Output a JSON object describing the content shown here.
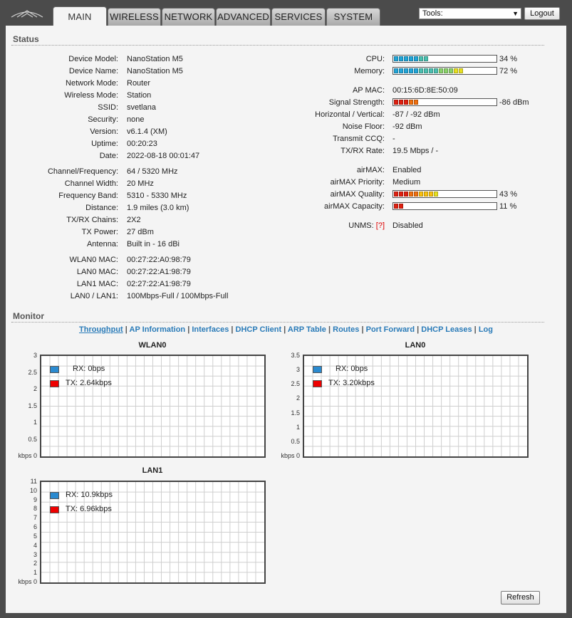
{
  "header": {
    "tabs": [
      {
        "label": "MAIN",
        "active": true
      },
      {
        "label": "WIRELESS"
      },
      {
        "label": "NETWORK"
      },
      {
        "label": "ADVANCED"
      },
      {
        "label": "SERVICES"
      },
      {
        "label": "SYSTEM"
      }
    ],
    "tools_label": "Tools:",
    "logout_label": "Logout",
    "logo_icon": "ubiquiti-logo-icon"
  },
  "status": {
    "title": "Status",
    "left": [
      {
        "label": "Device Model:",
        "value": "NanoStation M5"
      },
      {
        "label": "Device Name:",
        "value": "NanoStation M5"
      },
      {
        "label": "Network Mode:",
        "value": "Router"
      },
      {
        "label": "Wireless Mode:",
        "value": "Station"
      },
      {
        "label": "SSID:",
        "value": "svetlana"
      },
      {
        "label": "Security:",
        "value": "none"
      },
      {
        "label": "Version:",
        "value": "v6.1.4 (XM)"
      },
      {
        "label": "Uptime:",
        "value": "00:20:23"
      },
      {
        "label": "Date:",
        "value": "2022-08-18 00:01:47"
      },
      {
        "label": "Channel/Frequency:",
        "value": "64 / 5320 MHz"
      },
      {
        "label": "Channel Width:",
        "value": "20 MHz"
      },
      {
        "label": "Frequency Band:",
        "value": "5310 - 5330 MHz"
      },
      {
        "label": "Distance:",
        "value": "1.9 miles (3.0 km)"
      },
      {
        "label": "TX/RX Chains:",
        "value": "2X2"
      },
      {
        "label": "TX Power:",
        "value": "27 dBm"
      },
      {
        "label": "Antenna:",
        "value": "Built in - 16 dBi"
      },
      {
        "label": "WLAN0 MAC:",
        "value": "00:27:22:A0:98:79"
      },
      {
        "label": "LAN0 MAC:",
        "value": "00:27:22:A1:98:79"
      },
      {
        "label": "LAN1 MAC:",
        "value": "02:27:22:A1:98:79"
      },
      {
        "label": "LAN0 / LAN1:",
        "value": "100Mbps-Full / 100Mbps-Full"
      }
    ],
    "cpu": {
      "label": "CPU:",
      "value": "34 %",
      "percent": 34
    },
    "memory": {
      "label": "Memory:",
      "value": "72 %",
      "percent": 72
    },
    "ap_mac": {
      "label": "AP MAC:",
      "value": "00:15:6D:8E:50:09"
    },
    "signal": {
      "label": "Signal Strength:",
      "value": "-86 dBm",
      "percent": 25
    },
    "hv": {
      "label": "Horizontal / Vertical:",
      "value": "-87 / -92 dBm"
    },
    "noise": {
      "label": "Noise Floor:",
      "value": "-92 dBm"
    },
    "ccq": {
      "label": "Transmit CCQ:",
      "value": "-"
    },
    "txrx": {
      "label": "TX/RX Rate:",
      "value": "19.5 Mbps / -"
    },
    "airmax": {
      "label": "airMAX:",
      "value": "Enabled"
    },
    "airmax_priority": {
      "label": "airMAX Priority:",
      "value": "Medium"
    },
    "airmax_quality": {
      "label": "airMAX Quality:",
      "value": "43 %",
      "percent": 43
    },
    "airmax_capacity": {
      "label": "airMAX Capacity:",
      "value": "11 %",
      "percent": 11
    },
    "unms": {
      "label": "UNMS:",
      "help": "[?]",
      "value": "Disabled"
    }
  },
  "monitor": {
    "title": "Monitor",
    "links": [
      {
        "label": "Throughput",
        "active": true
      },
      {
        "label": "AP Information"
      },
      {
        "label": "Interfaces"
      },
      {
        "label": "DHCP Client"
      },
      {
        "label": "ARP Table"
      },
      {
        "label": "Routes"
      },
      {
        "label": "Port Forward"
      },
      {
        "label": "DHCP Leases"
      },
      {
        "label": "Log"
      }
    ],
    "graphs": [
      {
        "title": "WLAN0",
        "ticks": [
          "3",
          "2.5",
          "2",
          "1.5",
          "1",
          "0.5",
          "kbps 0"
        ],
        "rx": "RX: 0bps",
        "tx": "TX: 2.64kbps"
      },
      {
        "title": "LAN0",
        "ticks": [
          "3.5",
          "3",
          "2.5",
          "2",
          "1.5",
          "1",
          "0.5",
          "kbps 0"
        ],
        "rx": "RX: 0bps",
        "tx": "TX: 3.20kbps"
      },
      {
        "title": "LAN1",
        "ticks": [
          "11",
          "10",
          "9",
          "8",
          "7",
          "6",
          "5",
          "4",
          "3",
          "2",
          "1",
          "kbps 0"
        ],
        "rx": "RX: 10.9kbps",
        "tx": "TX: 6.96kbps"
      }
    ],
    "rx_color": "#2a8ad0",
    "tx_color": "#ee0000",
    "refresh_label": "Refresh"
  }
}
